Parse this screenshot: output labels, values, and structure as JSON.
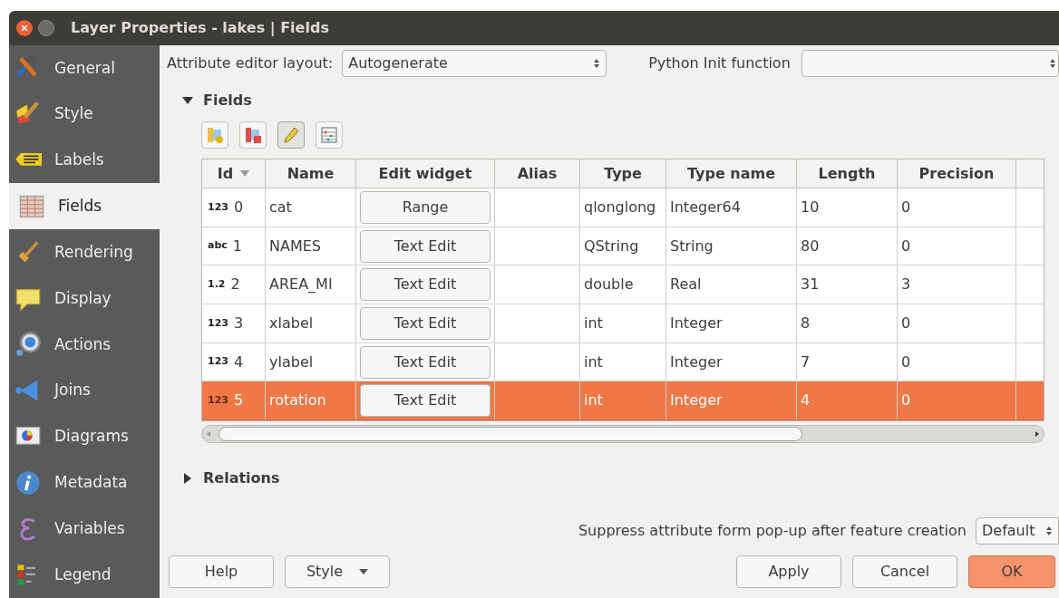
{
  "window": {
    "title": "Layer Properties - lakes | Fields"
  },
  "sidebar": {
    "items": [
      {
        "label": "General",
        "selected": false
      },
      {
        "label": "Style",
        "selected": false
      },
      {
        "label": "Labels",
        "selected": false
      },
      {
        "label": "Fields",
        "selected": true
      },
      {
        "label": "Rendering",
        "selected": false
      },
      {
        "label": "Display",
        "selected": false
      },
      {
        "label": "Actions",
        "selected": false
      },
      {
        "label": "Joins",
        "selected": false
      },
      {
        "label": "Diagrams",
        "selected": false
      },
      {
        "label": "Metadata",
        "selected": false
      },
      {
        "label": "Variables",
        "selected": false
      },
      {
        "label": "Legend",
        "selected": false
      }
    ]
  },
  "layout_row": {
    "label": "Attribute editor layout:",
    "value": "Autogenerate",
    "python_label": "Python Init function"
  },
  "fields_section": {
    "title": "Fields",
    "expanded": true
  },
  "table": {
    "columns": [
      "Id",
      "Name",
      "Edit widget",
      "Alias",
      "Type",
      "Type name",
      "Length",
      "Precision"
    ],
    "rows": [
      {
        "type_badge": "123",
        "id": "0",
        "name": "cat",
        "edit_widget": "Range",
        "alias": "",
        "type": "qlonglong",
        "type_name": "Integer64",
        "length": "10",
        "precision": "0",
        "selected": false
      },
      {
        "type_badge": "abc",
        "id": "1",
        "name": "NAMES",
        "edit_widget": "Text Edit",
        "alias": "",
        "type": "QString",
        "type_name": "String",
        "length": "80",
        "precision": "0",
        "selected": false
      },
      {
        "type_badge": "1.2",
        "id": "2",
        "name": "AREA_MI",
        "edit_widget": "Text Edit",
        "alias": "",
        "type": "double",
        "type_name": "Real",
        "length": "31",
        "precision": "3",
        "selected": false
      },
      {
        "type_badge": "123",
        "id": "3",
        "name": "xlabel",
        "edit_widget": "Text Edit",
        "alias": "",
        "type": "int",
        "type_name": "Integer",
        "length": "8",
        "precision": "0",
        "selected": false
      },
      {
        "type_badge": "123",
        "id": "4",
        "name": "ylabel",
        "edit_widget": "Text Edit",
        "alias": "",
        "type": "int",
        "type_name": "Integer",
        "length": "7",
        "precision": "0",
        "selected": false
      },
      {
        "type_badge": "123",
        "id": "5",
        "name": "rotation",
        "edit_widget": "Text Edit",
        "alias": "",
        "type": "int",
        "type_name": "Integer",
        "length": "4",
        "precision": "0",
        "selected": true
      }
    ]
  },
  "relations_section": {
    "title": "Relations",
    "expanded": false
  },
  "suppress_row": {
    "label": "Suppress attribute form pop-up after feature creation",
    "value": "Default"
  },
  "buttons": [
    {
      "label": "Help",
      "dropdown": false,
      "default": false
    },
    {
      "label": "Style",
      "dropdown": true,
      "default": false
    },
    {
      "label": "Apply",
      "dropdown": false,
      "default": false
    },
    {
      "label": "Cancel",
      "dropdown": false,
      "default": false
    },
    {
      "label": "OK",
      "dropdown": false,
      "default": true
    }
  ]
}
